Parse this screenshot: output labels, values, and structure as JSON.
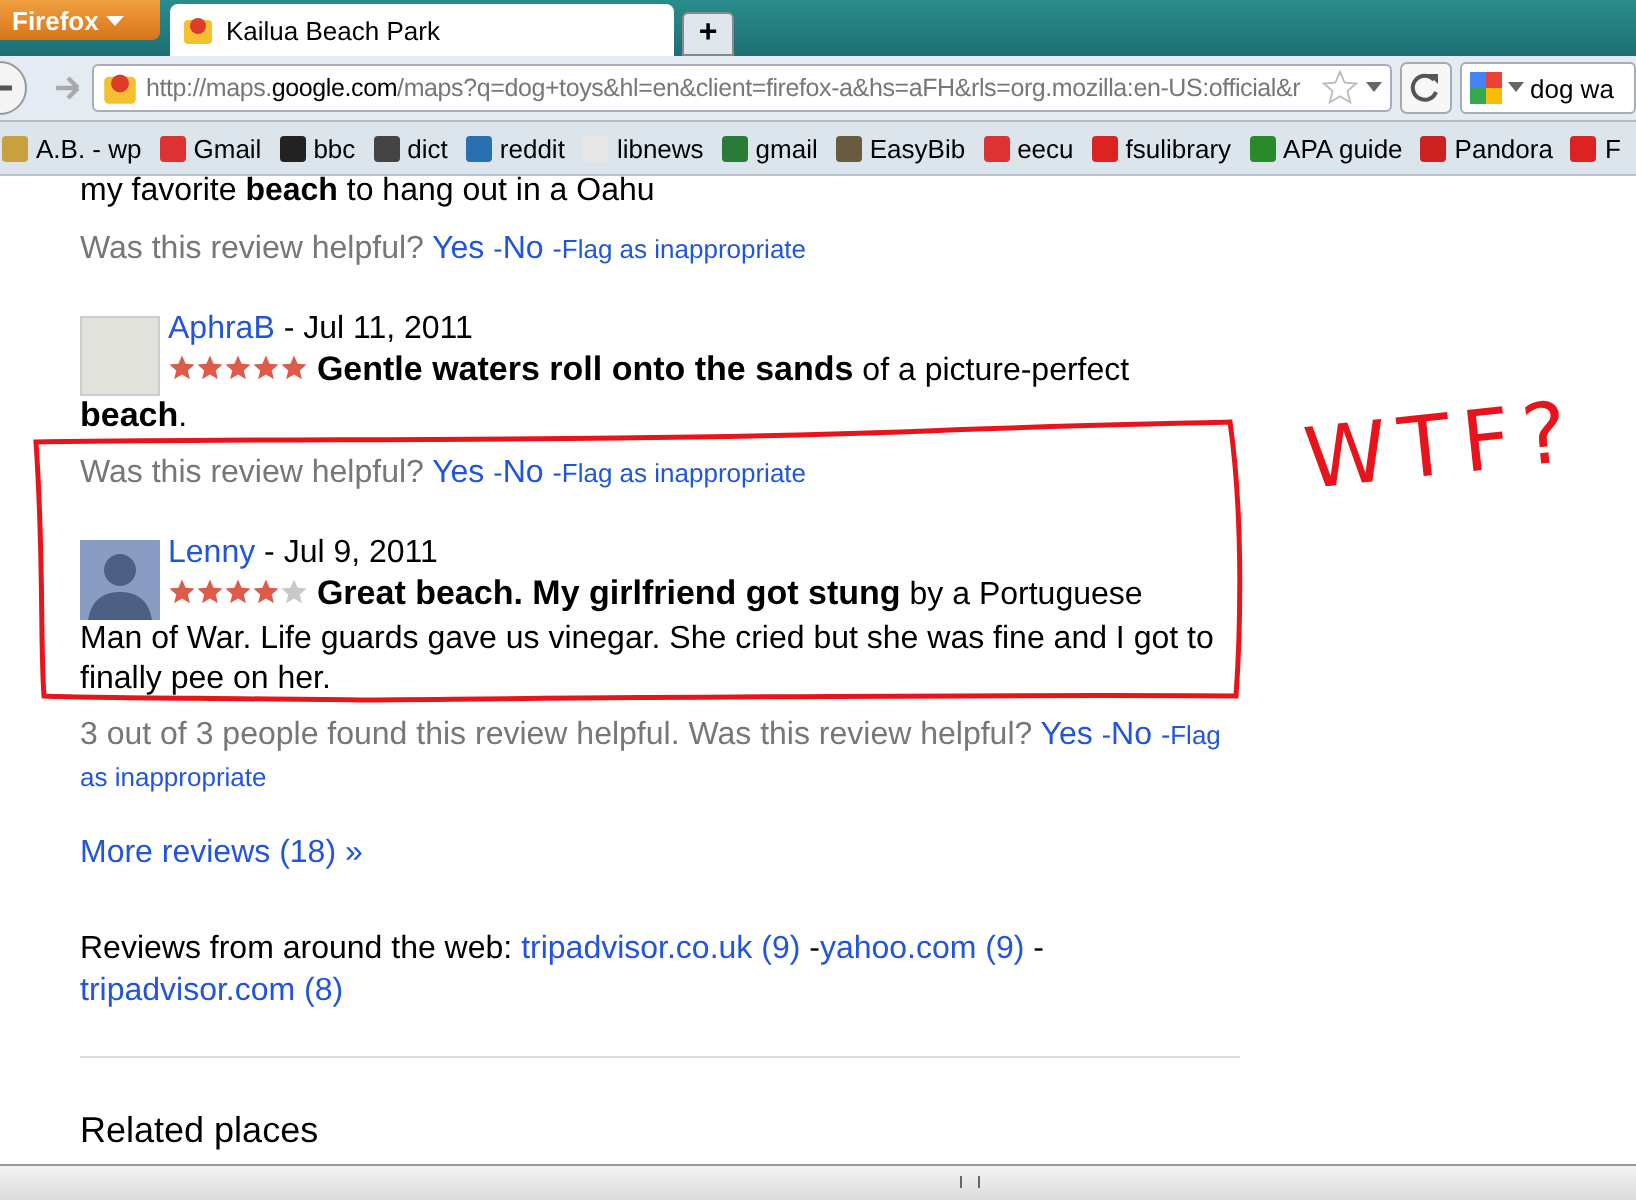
{
  "browser": {
    "app_button": "Firefox",
    "tabs": [
      {
        "title": "Kailua Beach Park",
        "selected": true
      }
    ],
    "new_tab": "+",
    "url": "http://maps.**google.com**/maps?q=dog+toys&hl=en&client=firefox-a&hs=aFH&rls=org.mozilla:en-US:official&r",
    "search_value": "dog wa",
    "bookmarks": [
      {
        "label": "A.B. - wp"
      },
      {
        "label": "Gmail"
      },
      {
        "label": "bbc"
      },
      {
        "label": "dict"
      },
      {
        "label": "reddit"
      },
      {
        "label": "libnews"
      },
      {
        "label": "gmail"
      },
      {
        "label": "EasyBib"
      },
      {
        "label": "eecu"
      },
      {
        "label": "fsulibrary"
      },
      {
        "label": "APA guide"
      },
      {
        "label": "Pandora"
      },
      {
        "label": "F"
      }
    ]
  },
  "reviews": [
    {
      "kind": "partial",
      "text": "my favorite **beach** to hang out in a Oahu",
      "question": "Was this review helpful?",
      "links": [
        {
          "kind": "vote",
          "label": "Yes",
          "trail": "-"
        },
        {
          "kind": "vote",
          "label": "No",
          "trail": "-"
        },
        {
          "kind": "flag",
          "label": "Flag as inappropriate"
        }
      ]
    },
    {
      "kind": "full",
      "author": "AphraB",
      "date": "- Jul 11, 2011",
      "avatar": {
        "kind": "photo"
      },
      "stars": 5,
      "text": "**Gentle waters roll onto the sands** of a picture-perfect",
      "text_continued": "**beach**.",
      "question": "Was this review helpful?",
      "links": [
        {
          "kind": "vote",
          "label": "Yes",
          "trail": "-"
        },
        {
          "kind": "vote",
          "label": "No",
          "trail": "-"
        },
        {
          "kind": "flag",
          "label": "Flag as inappropriate"
        }
      ]
    },
    {
      "kind": "full",
      "author": "Lenny",
      "date": "- Jul 9, 2011",
      "avatar": {
        "kind": "silhouette"
      },
      "stars": 4,
      "text": "**Great beach. My girlfriend got stung** by a Portuguese",
      "text_continued": "Man of War. Life guards gave us vinegar. She cried but she was fine and I got to finally pee on her.",
      "helpful_count": "3 out of 3 people found this review helpful.",
      "question": "Was this review helpful?",
      "links": [
        {
          "kind": "vote",
          "label": "Yes",
          "trail": "-"
        },
        {
          "kind": "vote",
          "label": "No",
          "trail": "-"
        },
        {
          "kind": "flag",
          "label": "Flag"
        },
        {
          "kind": "flag",
          "label": "as inappropriate"
        }
      ]
    }
  ],
  "more_reviews": "More reviews (18) »",
  "web_reviews": {
    "label": "Reviews from around the web:",
    "links": [
      {
        "label": "tripadvisor.co.uk (9)",
        "trail": "-"
      },
      {
        "label": "yahoo.com (9)",
        "trail": "-"
      },
      {
        "label": "tripadvisor.com (8)"
      }
    ]
  },
  "related_heading": "Related places",
  "annotation": {
    "text": "WTF?"
  }
}
